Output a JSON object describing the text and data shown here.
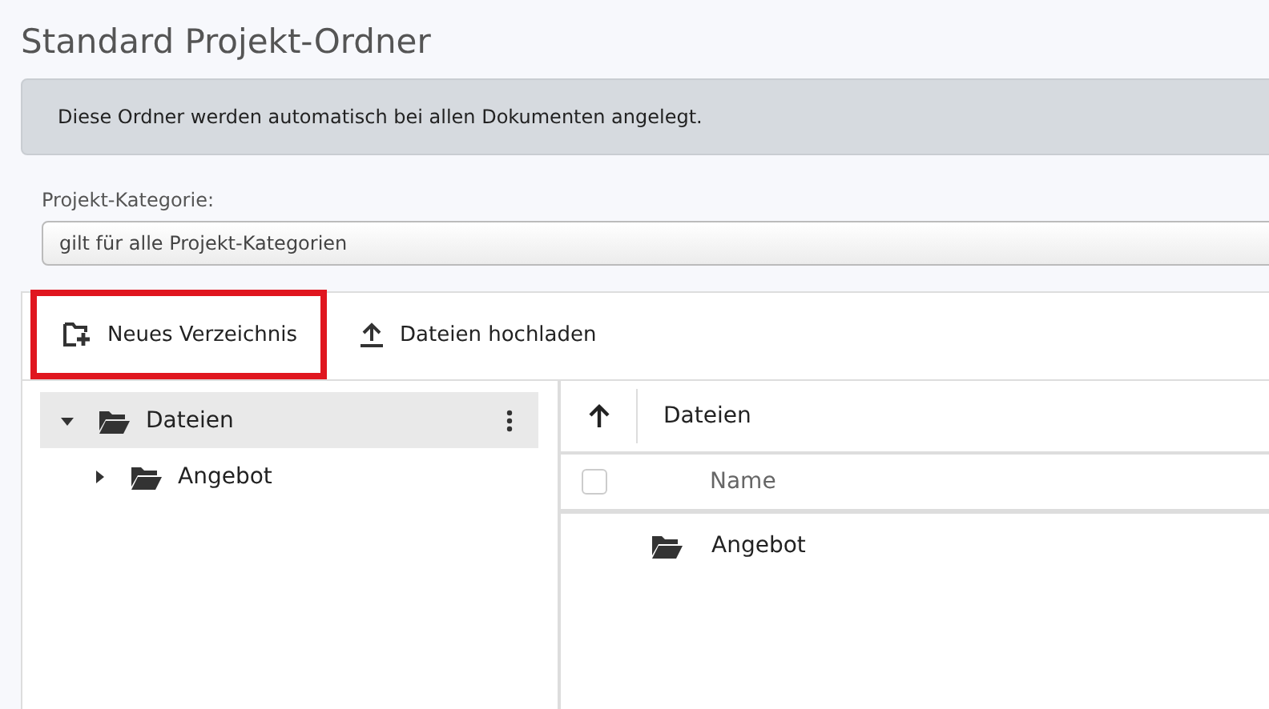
{
  "page_title": "Standard Projekt-Ordner",
  "info_message": "Diese Ordner werden automatisch bei allen Dokumenten angelegt.",
  "category": {
    "label": "Projekt-Kategorie:",
    "value": "gilt für alle Projekt-Kategorien"
  },
  "toolbar": [
    {
      "kind": "new-folder",
      "label": "Neues Verzeichnis",
      "highlighted": true
    },
    {
      "kind": "upload",
      "label": "Dateien hochladen",
      "highlighted": false
    }
  ],
  "tree": [
    {
      "label": "Dateien",
      "expanded": true,
      "selected": true,
      "children": [
        {
          "label": "Angebot",
          "expanded": false,
          "selected": false
        }
      ]
    }
  ],
  "file_list": {
    "path": "Dateien",
    "columns": [
      "Name"
    ],
    "select_all": {
      "checked": false
    },
    "rows": [
      {
        "kind": "folder",
        "name": "Angebot"
      }
    ]
  }
}
